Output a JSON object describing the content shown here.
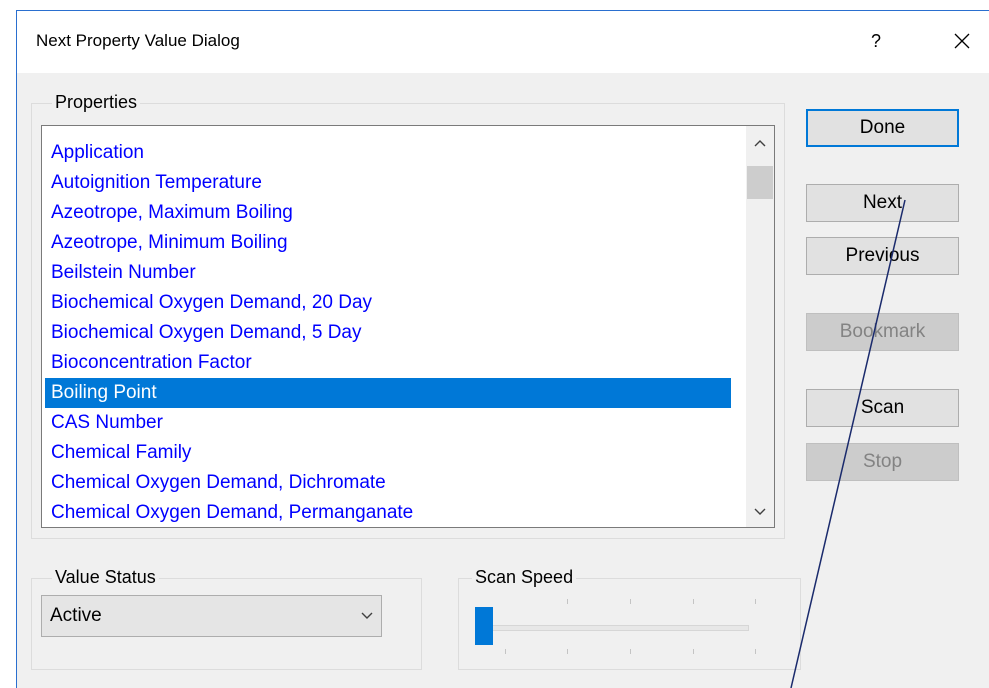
{
  "dialog": {
    "title": "Next Property Value Dialog",
    "help_label": "?"
  },
  "properties_group": {
    "label": "Properties",
    "items": [
      "Application",
      "Autoignition Temperature",
      "Azeotrope, Maximum Boiling",
      "Azeotrope, Minimum Boiling",
      "Beilstein Number",
      "Biochemical Oxygen Demand, 20 Day",
      "Biochemical Oxygen Demand, 5 Day",
      "Bioconcentration Factor",
      "Boiling Point",
      "CAS Number",
      "Chemical Family",
      "Chemical Oxygen Demand, Dichromate",
      "Chemical Oxygen Demand, Permanganate"
    ],
    "selected_item": "Boiling Point"
  },
  "buttons": {
    "done": "Done",
    "next": "Next",
    "previous": "Previous",
    "bookmark": "Bookmark",
    "scan": "Scan",
    "stop": "Stop"
  },
  "value_status": {
    "label": "Value Status",
    "selected": "Active"
  },
  "scan_speed": {
    "label": "Scan Speed",
    "level": 0
  },
  "colors": {
    "list_text": "#0000ff",
    "selection": "#0078d7",
    "annotation_line": "#1a2a6c"
  },
  "icons": {
    "close": "close-icon",
    "scroll_up": "chevron-up-icon",
    "scroll_down": "chevron-down-icon",
    "combo": "chevron-down-icon"
  }
}
